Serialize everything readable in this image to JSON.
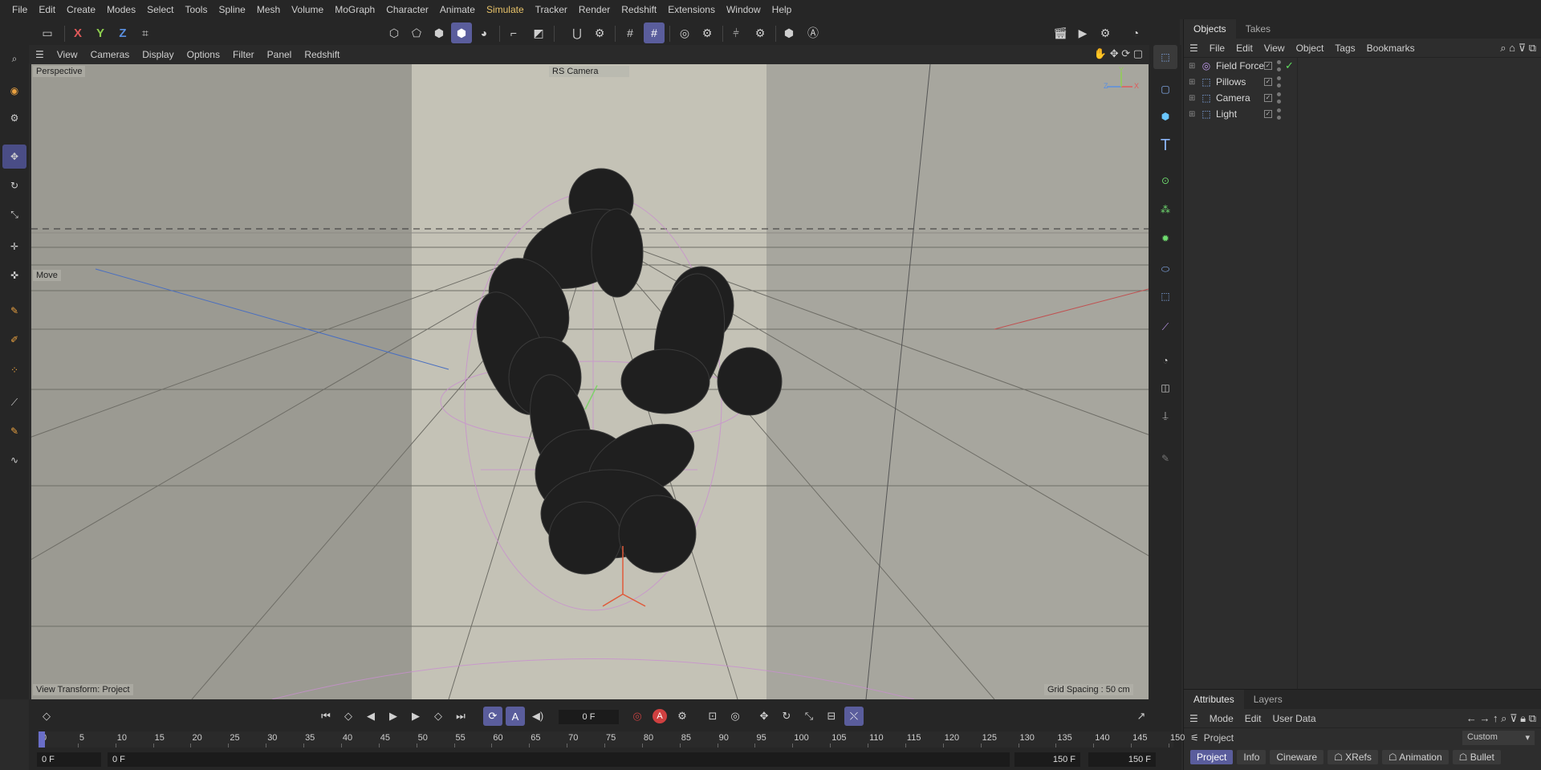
{
  "menubar": {
    "items": [
      "File",
      "Edit",
      "Create",
      "Modes",
      "Select",
      "Tools",
      "Spline",
      "Mesh",
      "Volume",
      "MoGraph",
      "Character",
      "Animate",
      "Simulate",
      "Tracker",
      "Render",
      "Redshift",
      "Extensions",
      "Window",
      "Help"
    ],
    "active": "Simulate",
    "active_color": "#e8c36a"
  },
  "toolbar": {
    "axis_x": "X",
    "axis_y": "Y",
    "axis_z": "Z",
    "axis_x_color": "#e05a5a",
    "axis_y_color": "#8fd14f",
    "axis_z_color": "#5a8fe0"
  },
  "viewport": {
    "menu": [
      "View",
      "Cameras",
      "Display",
      "Options",
      "Filter",
      "Panel",
      "Redshift"
    ],
    "label_perspective": "Perspective",
    "label_camera": "RS Camera",
    "label_move": "Move",
    "label_view_transform": "View Transform: Project",
    "label_grid_spacing": "Grid Spacing : 50 cm",
    "gizmo_x": "X",
    "gizmo_y": "Y",
    "gizmo_z": "Z"
  },
  "objects": {
    "tabs": [
      "Objects",
      "Takes"
    ],
    "menu": [
      "File",
      "Edit",
      "View",
      "Object",
      "Tags",
      "Bookmarks"
    ],
    "items": [
      {
        "name": "Field Force",
        "icon": "field-force-icon"
      },
      {
        "name": "Pillows",
        "icon": "null-object-icon"
      },
      {
        "name": "Camera",
        "icon": "null-object-icon"
      },
      {
        "name": "Light",
        "icon": "null-object-icon"
      }
    ]
  },
  "attributes": {
    "tabs": [
      "Attributes",
      "Layers"
    ],
    "menu": [
      "Mode",
      "Edit",
      "User Data"
    ],
    "project_label": "Project",
    "preset_value": "Custom",
    "sections": [
      "Project",
      "Info",
      "Cineware",
      "XRefs",
      "Animation",
      "Bullet"
    ]
  },
  "timeline": {
    "current_frame": "0 F",
    "ticks": [
      "0",
      "5",
      "10",
      "15",
      "20",
      "25",
      "30",
      "35",
      "40",
      "45",
      "50",
      "55",
      "60",
      "65",
      "70",
      "75",
      "80",
      "85",
      "90",
      "95",
      "100",
      "105",
      "110",
      "115",
      "120",
      "125",
      "130",
      "135",
      "140",
      "145",
      "150"
    ],
    "start_field": "0 F",
    "min_field": "0 F",
    "end_field": "150 F",
    "max_field": "150 F"
  }
}
